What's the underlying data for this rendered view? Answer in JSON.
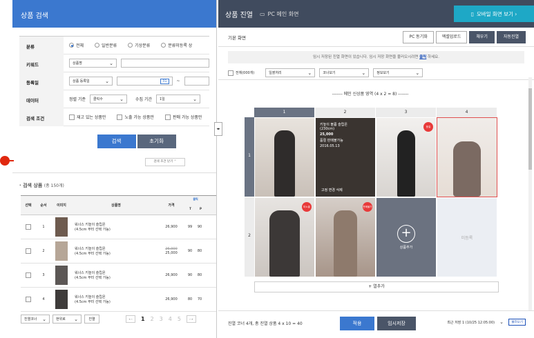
{
  "left": {
    "title": "상품 검색",
    "form": {
      "category_label": "분류",
      "category_options": [
        "전체",
        "일반분류",
        "기상분류",
        "분류미등록 상"
      ],
      "keyword_label": "키워드",
      "keyword_select": "상품명",
      "date_label": "등록일",
      "date_select": "상품 등록일",
      "date_cal": "31",
      "date_sep": "~",
      "data_label": "데이터",
      "sort_label": "정렬 기준",
      "sort_select": "클릭수",
      "period_label": "수집 기간",
      "period_select": "1일",
      "cond_label": "검색 조건",
      "cond_options": [
        "재고 있는 상품만",
        "노출 가능 상품만",
        "판매 가능 상품만"
      ]
    },
    "search_button": "검색",
    "reset_button": "초기화",
    "fold_button": "검색 조건 닫기 ⌃",
    "result_title": "· 검색 상품",
    "result_count": "(총 150개)",
    "table": {
      "headers": [
        "선택",
        "순서",
        "이미지",
        "상품명",
        "가격",
        "클릭",
        "T",
        "P"
      ],
      "rows": [
        {
          "no": "1",
          "name1": "워너스 키높이 슬립온",
          "name2": "(4.5cm 부터 선택 가능)",
          "price": "26,900",
          "price_old": "",
          "t": "99",
          "p": "90"
        },
        {
          "no": "2",
          "name1": "워너스 키높이 슬립온",
          "name2": "(4.5cm 부터 선택 가능)",
          "price": "25,000",
          "price_old": "26,900",
          "t": "90",
          "p": "80"
        },
        {
          "no": "3",
          "name1": "워너스 키높이 슬립온",
          "name2": "(4.5cm 부터 선택 가능)",
          "price": "26,900",
          "price_old": "",
          "t": "90",
          "p": "80"
        },
        {
          "no": "4",
          "name1": "워너스 키높이 슬립온",
          "name2": "(4.5cm 부터 선택 가능)",
          "price": "26,900",
          "price_old": "",
          "t": "80",
          "p": "70"
        }
      ]
    },
    "footer": {
      "corner_select": "진열코너",
      "select2": "현위로",
      "display_btn": "진열",
      "pages": [
        "1",
        "2",
        "3",
        "4",
        "5"
      ]
    }
  },
  "right": {
    "title": "상품 진열",
    "subtitle": "PC 메인 화면",
    "mobile_btn": "모바일 화면 보기 ›",
    "basic_label": "기본 화면",
    "buttons": [
      "PC 동기화",
      "엑셀업로드",
      "채우기",
      "자동진열"
    ],
    "notice": "임시 저장된 진열 화면이 있습니다. 임시 저장 화면을 불러오시려면",
    "notice_link": "클릭",
    "notice_tail": "하세요.",
    "bar2": {
      "all_label": "전체(000개)",
      "select1": "일괄처리",
      "select2": "코너보기",
      "select3": "정보보기"
    },
    "area_title": "------- 메인 신상품 영역 (4 x 2 = 8) -------",
    "col_heads": [
      "1",
      "2",
      "3",
      "4"
    ],
    "row_heads": [
      "1",
      "2"
    ],
    "overlay": {
      "line1": "키높이 볼륨 슬립온",
      "line2": "(230cm)",
      "price": "25,000",
      "tags": "품절    판매불가능",
      "date": "2016.05.13",
      "actions": "고정     변경     삭제"
    },
    "badges": {
      "c13": "품절",
      "c21": "미노출",
      "c22": "판매불가"
    },
    "add_product": "상품추가",
    "empty_cell": "미등록",
    "add_row": "+ 열추가",
    "footer_info": "진열 코너 4개, 총 진열 상품 4 x 10 = 40",
    "apply_btn": "적용",
    "temp_save_btn": "임시저장",
    "recent_select": "최근 저장 1 (10/25 12:05:00)",
    "load_btn": "불러오기"
  }
}
